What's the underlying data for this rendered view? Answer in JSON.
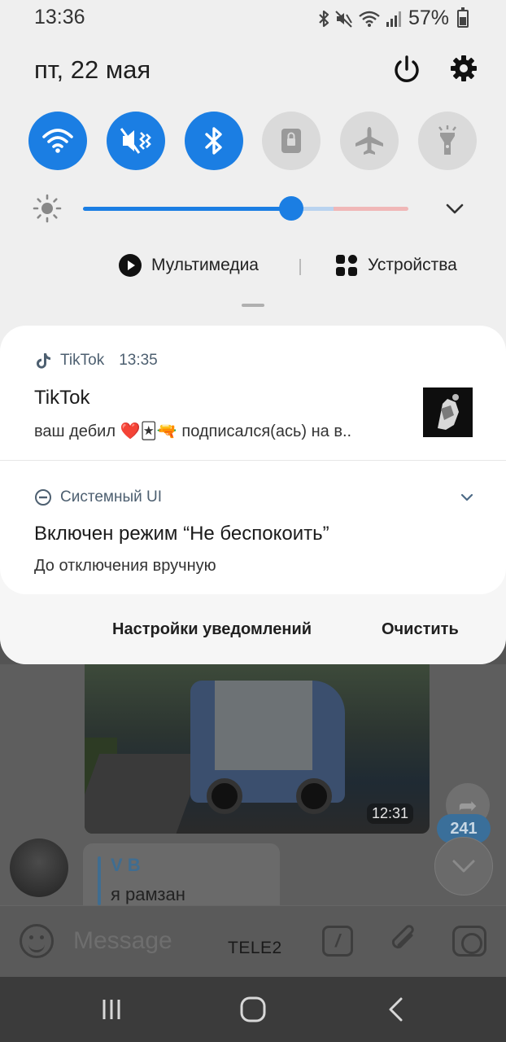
{
  "status_bar": {
    "time": "13:36",
    "battery_percent": "57%"
  },
  "quick_panel": {
    "date": "пт, 22 мая",
    "toggles": [
      {
        "name": "wifi",
        "on": true
      },
      {
        "name": "sound-vibrate",
        "on": true
      },
      {
        "name": "bluetooth",
        "on": true
      },
      {
        "name": "portrait-lock",
        "on": false
      },
      {
        "name": "airplane",
        "on": false
      },
      {
        "name": "flashlight",
        "on": false
      }
    ],
    "brightness_fraction": 0.64,
    "media_label": "Мультимедиа",
    "devices_label": "Устройства"
  },
  "notifications": [
    {
      "app": "TikTok",
      "time": "13:35",
      "title": "TikTok",
      "text": "ваш дебил ❤️🃏🔫 подписался(ась) на в.."
    },
    {
      "app": "Системный UI",
      "title": "Включен режим “Не беспокоить”",
      "text": "До отключения вручную"
    }
  ],
  "actions": {
    "settings_label": "Настройки уведомлений",
    "clear_label": "Очистить"
  },
  "background_app": {
    "photo_time": "12:31",
    "unread_count": "241",
    "reply_name": "V B",
    "reply_text": "я рамзан",
    "message_placeholder": "Message",
    "carrier": "TELE2"
  },
  "colors": {
    "accent": "#1b7ee3",
    "shade_bg": "#efefef",
    "card_bg": "#ffffff"
  }
}
